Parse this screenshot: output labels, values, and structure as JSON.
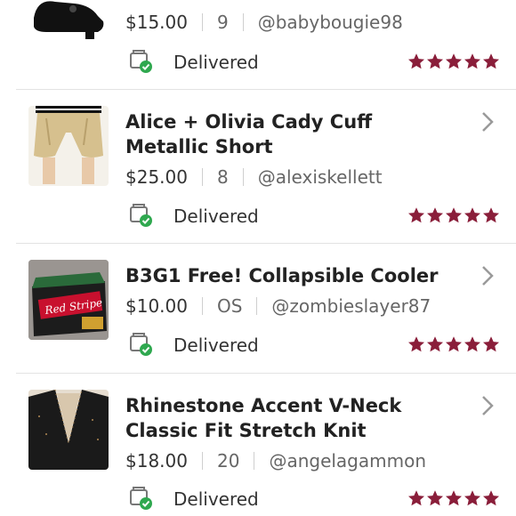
{
  "orders": [
    {
      "title": "",
      "price": "$15.00",
      "size": "9",
      "seller": "@babybougie98",
      "status": "Delivered",
      "rating": 5
    },
    {
      "title": "Alice + Olivia Cady Cuff Metallic Short",
      "price": "$25.00",
      "size": "8",
      "seller": "@alexiskellett",
      "status": "Delivered",
      "rating": 5
    },
    {
      "title": "B3G1 Free! Collapsible Cooler",
      "price": "$10.00",
      "size": "OS",
      "seller": "@zombieslayer87",
      "status": "Delivered",
      "rating": 5,
      "product_label": "Red Stripe"
    },
    {
      "title": "Rhinestone Accent V-Neck Classic Fit Stretch Knit",
      "price": "$18.00",
      "size": "20",
      "seller": "@angelagammon",
      "status": "Delivered",
      "rating": 5
    }
  ],
  "colors": {
    "star": "#8a1e3a",
    "delivered_check": "#2fa84f",
    "divider": "#e3e3e3"
  },
  "icons": {
    "delivered": "package-check-icon",
    "chevron": "chevron-right-icon",
    "star": "star-icon"
  }
}
